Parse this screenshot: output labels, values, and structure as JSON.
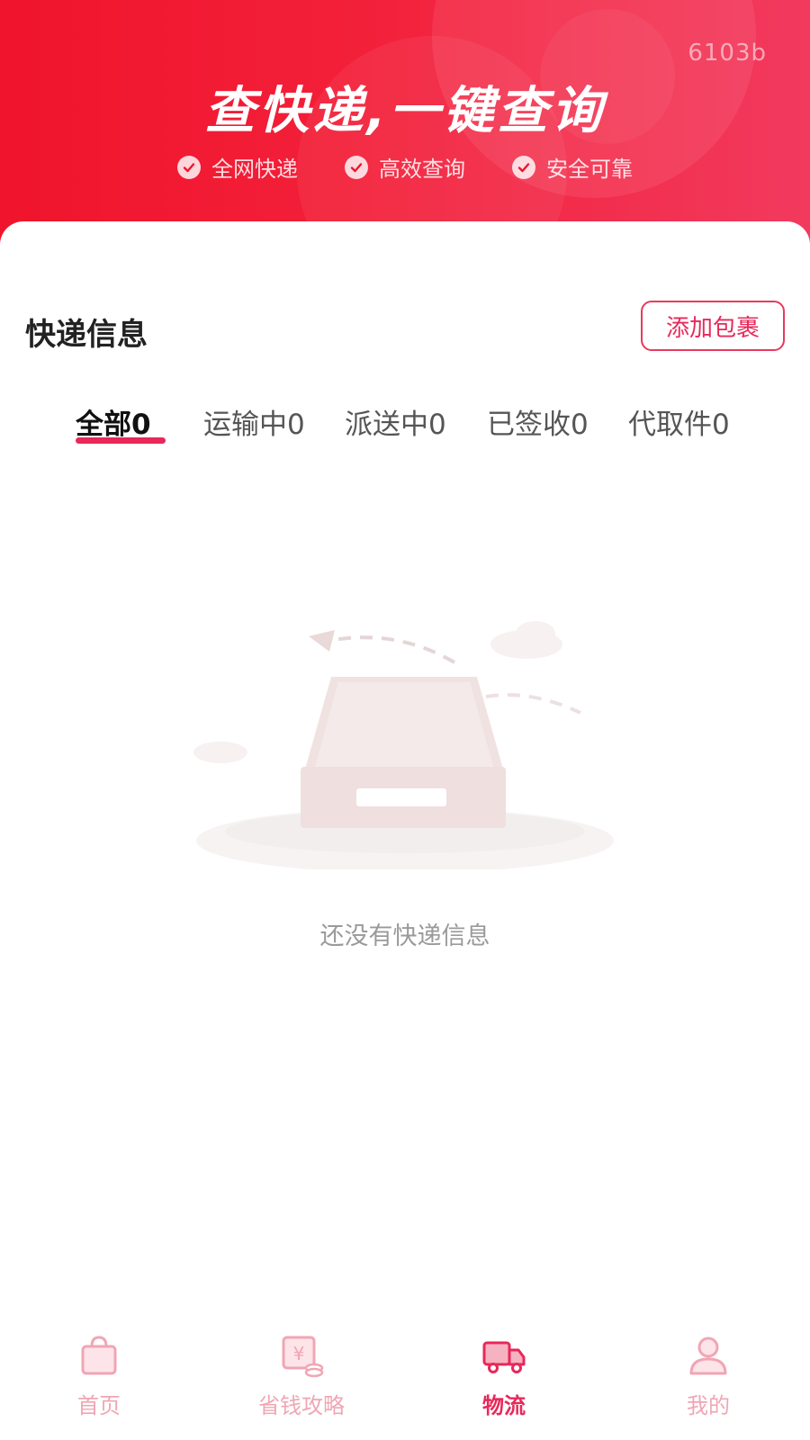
{
  "header": {
    "version": "6103b",
    "title": "查快递,一键查询",
    "features": [
      "全网快递",
      "高效查询",
      "安全可靠"
    ]
  },
  "main": {
    "section_title": "快递信息",
    "add_button_label": "添加包裹",
    "tabs": [
      {
        "label": "全部0",
        "active": true
      },
      {
        "label": "运输中0",
        "active": false
      },
      {
        "label": "派送中0",
        "active": false
      },
      {
        "label": "已签收0",
        "active": false
      },
      {
        "label": "代取件0",
        "active": false
      }
    ],
    "empty_text": "还没有快递信息"
  },
  "bottom_nav": {
    "items": [
      {
        "label": "首页",
        "icon": "bag-icon",
        "active": false
      },
      {
        "label": "省钱攻略",
        "icon": "coupon-icon",
        "active": false
      },
      {
        "label": "物流",
        "icon": "truck-icon",
        "active": true
      },
      {
        "label": "我的",
        "icon": "user-icon",
        "active": false
      }
    ]
  },
  "colors": {
    "brand_red": "#f0142c",
    "accent_pink": "#e8285a",
    "inactive_nav": "#f0a6b4"
  }
}
